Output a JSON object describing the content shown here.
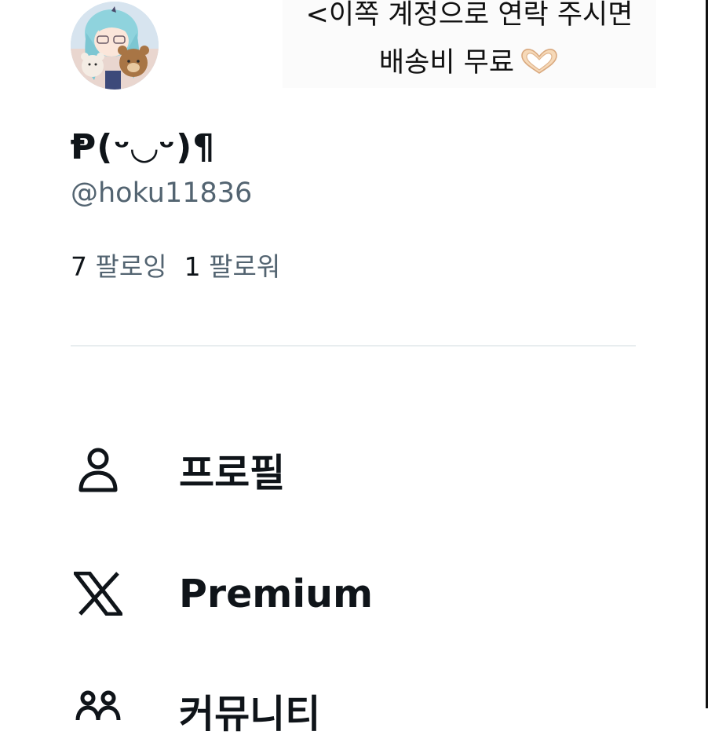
{
  "overlay_caption": {
    "line1": "<이쪽 계정으로 연락 주시면",
    "line2": "배송비 무료",
    "emoji_icon": "heart-hands-icon"
  },
  "profile": {
    "avatar_icon": "anime-avatar",
    "display_name": "Ᵽ(ᵕ◡ᵕ)¶",
    "handle": "@hoku11836",
    "following_count": "7",
    "following_label": "팔로잉",
    "followers_count": "1",
    "followers_label": "팔로워"
  },
  "menu": {
    "items": [
      {
        "icon": "person-icon",
        "label": "프로필"
      },
      {
        "icon": "x-logo-icon",
        "label": "Premium"
      },
      {
        "icon": "community-icon",
        "label": "커뮤니티"
      }
    ]
  },
  "colors": {
    "text_primary": "#0f1419",
    "text_secondary": "#536471",
    "divider": "#cfd9de",
    "background": "#ffffff"
  }
}
